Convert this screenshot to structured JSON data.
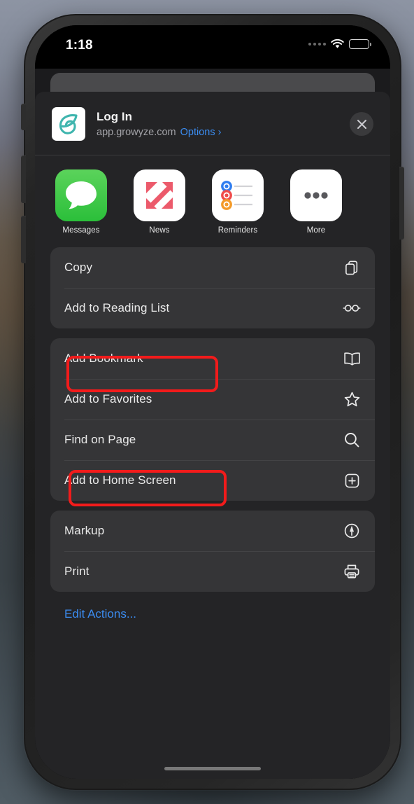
{
  "device": {
    "status_bar": {
      "time": "1:18",
      "signal_dots": 4,
      "wifi_icon": "wifi-icon",
      "battery_icon": "battery-full-icon",
      "battery_level_pct": 100
    },
    "home_indicator": "home-indicator"
  },
  "share_sheet": {
    "app_icon": "growyze-logo-icon",
    "title": "Log In",
    "domain": "app.growyze.com",
    "options_label": "Options",
    "options_chevron": "chevron-right-icon",
    "close_icon": "close-icon",
    "apps": [
      {
        "label": "Messages",
        "icon": "messages-icon"
      },
      {
        "label": "News",
        "icon": "news-icon"
      },
      {
        "label": "Reminders",
        "icon": "reminders-icon"
      },
      {
        "label": "More",
        "icon": "more-ellipsis-icon"
      }
    ],
    "groups": [
      {
        "items": [
          {
            "label": "Copy",
            "icon": "copy-icon",
            "highlighted": false
          },
          {
            "label": "Add to Reading List",
            "icon": "glasses-icon",
            "highlighted": false
          }
        ]
      },
      {
        "items": [
          {
            "label": "Add Bookmark",
            "icon": "book-icon",
            "highlighted": true
          },
          {
            "label": "Add to Favorites",
            "icon": "star-icon",
            "highlighted": false
          },
          {
            "label": "Find on Page",
            "icon": "search-icon",
            "highlighted": false
          },
          {
            "label": "Add to Home Screen",
            "icon": "plus-square-icon",
            "highlighted": true
          }
        ]
      },
      {
        "items": [
          {
            "label": "Markup",
            "icon": "markup-pen-icon",
            "highlighted": false
          },
          {
            "label": "Print",
            "icon": "printer-icon",
            "highlighted": false
          }
        ]
      }
    ],
    "edit_actions_label": "Edit Actions..."
  },
  "annotations": {
    "highlight_color": "#f21b1b",
    "highlighted_items": [
      "Add Bookmark",
      "Add to Home Screen"
    ]
  },
  "colors": {
    "sheet_background": "#242426",
    "row_background": "#353537",
    "accent_link": "#3b8cf0",
    "text_primary": "#eaeaea",
    "text_secondary": "#a3a3a8",
    "brand_logo": "#3fb5ae",
    "messages_green": "#2bbf3a",
    "news_red": "#ed5668",
    "reminder_blue": "#2f7df0",
    "reminder_red": "#ef4a4a",
    "reminder_orange": "#f49a28"
  }
}
